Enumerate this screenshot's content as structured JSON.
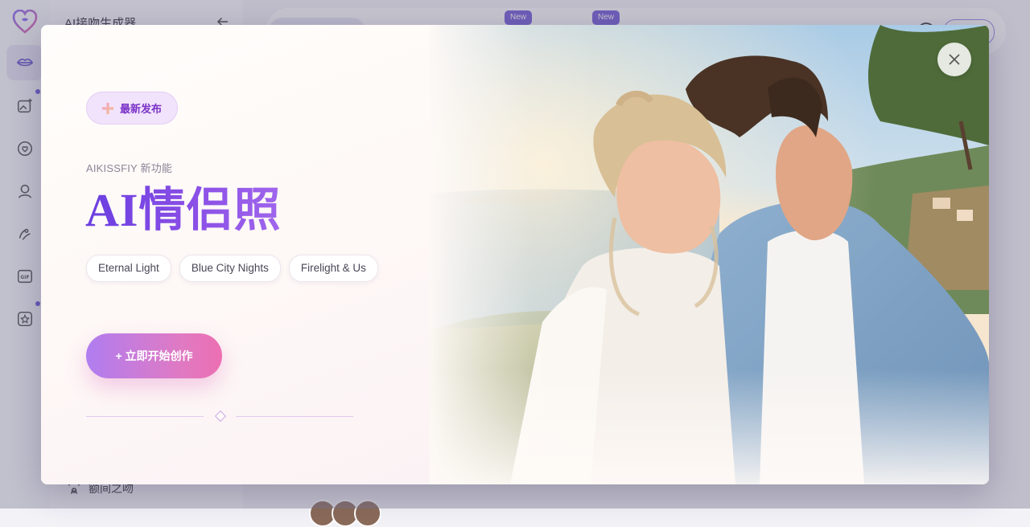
{
  "app": {
    "sidebar_title": "AI接吻生成器",
    "bottom_link": "额间之吻",
    "new_badges": [
      "New",
      "New"
    ]
  },
  "modal": {
    "badge": "最新发布",
    "eyebrow": "AIKISSFIY 新功能",
    "headline": "AI情侣照",
    "chips": [
      "Eternal Light",
      "Blue City Nights",
      "Firelight & Us"
    ],
    "cta": "+ 立即开始创作"
  },
  "colors": {
    "accent": "#7b4fe0",
    "cta_start": "#b07df0",
    "cta_end": "#ec6fb2",
    "badge_bg": "#f1e3fb"
  }
}
